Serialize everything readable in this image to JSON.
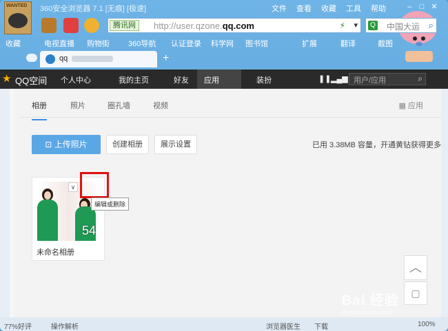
{
  "title_bar": {
    "title": "360安全浏览器 7.1 [无痕] [极速]",
    "menu": [
      "文件",
      "查看",
      "收藏",
      "工具",
      "帮助"
    ]
  },
  "address_bar": {
    "tag": "腾讯网",
    "url_prefix": "http://user.qzone.",
    "url_domain": "qq.com",
    "search_placeholder": "中国大运"
  },
  "bookmarks": [
    "收藏",
    "电视直播",
    "购物街",
    "360导航",
    "认证登录",
    "科学网",
    "图书馆",
    "扩展",
    "翻译",
    "截图"
  ],
  "browser_tab": {
    "title": "qq"
  },
  "qzone_nav": {
    "brand": "QQ空间",
    "items": [
      "个人中心",
      "我的主页",
      "好友",
      "应用",
      "装扮"
    ],
    "search_placeholder": "用户/应用"
  },
  "subtabs": [
    "相册",
    "照片",
    "圈孔墙",
    "视频"
  ],
  "apps_label": "应用",
  "toolbar": {
    "upload": "上传照片",
    "create_album": "创建相册",
    "display_settings": "展示设置",
    "usage": "已用 3.38MB 容量，开通黄钻获得更多"
  },
  "album": {
    "name": "未命名相册",
    "count": "54",
    "tooltip": "编辑或删除"
  },
  "status_bar": {
    "left1": "77%好评",
    "left2": "操作解析",
    "right1": "浏览器医生",
    "right2": "下载",
    "zoom": "100%"
  },
  "watermark": {
    "main": "Bai 经验",
    "sub": "jingyan.baidu.com"
  },
  "colors": {
    "accent": "#5aa7e6",
    "nav_bg": "#2a2a2a",
    "highlight": "#e01010"
  }
}
